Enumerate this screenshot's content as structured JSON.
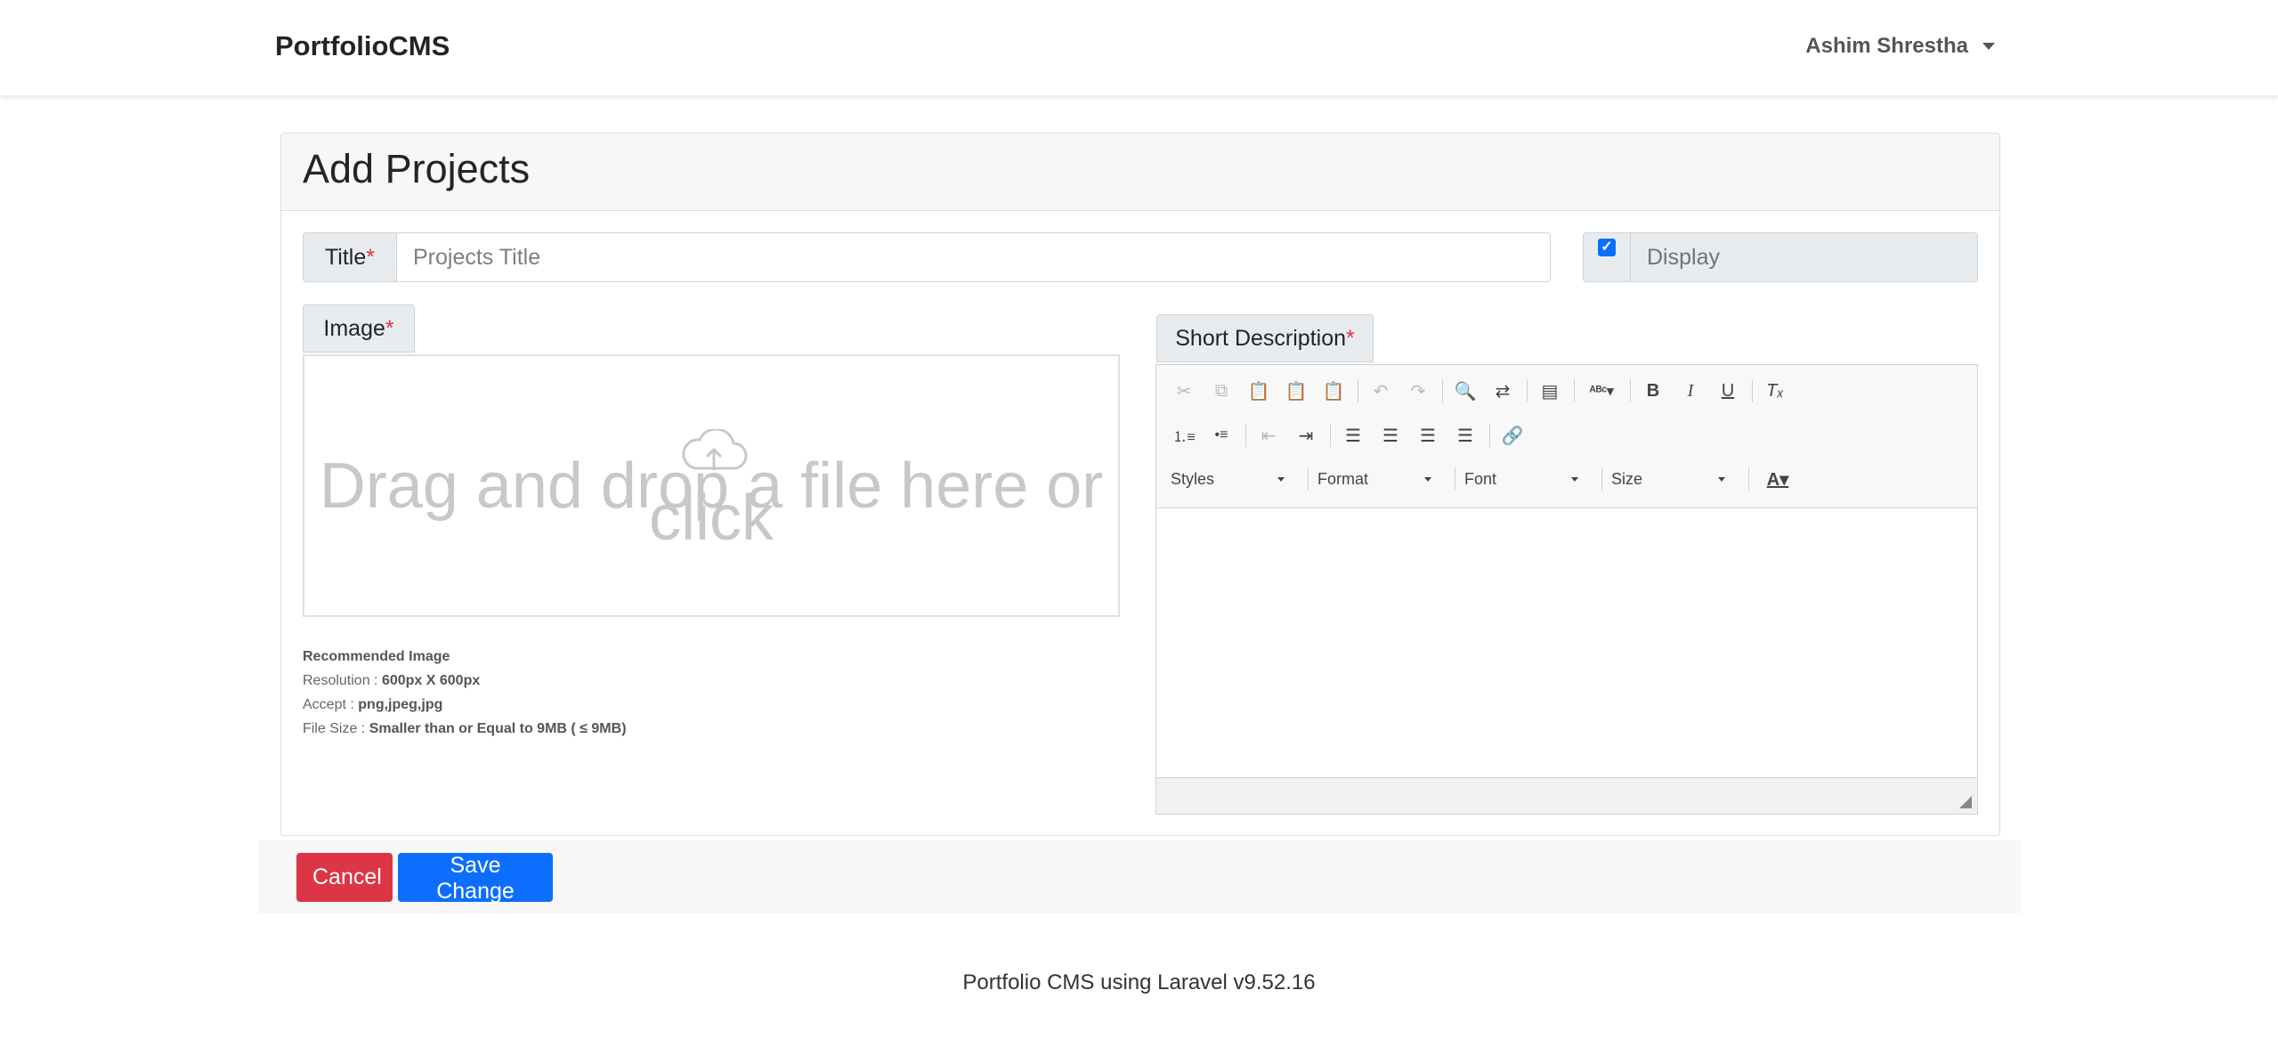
{
  "navbar": {
    "brand": "PortfolioCMS",
    "user_name": "Ashim Shrestha"
  },
  "card": {
    "title": "Add Projects",
    "title_field": {
      "label": "Title",
      "required_mark": "*",
      "placeholder": "Projects Title",
      "value": ""
    },
    "display": {
      "label": "Display",
      "checked": true
    },
    "image": {
      "label": "Image",
      "required_mark": "*",
      "dropzone_text": "Drag and drop a file here or click",
      "notes": {
        "heading": "Recommended Image",
        "resolution_label": "Resolution :",
        "resolution_value": "600px X 600px",
        "accept_label": "Accept :",
        "accept_value": "png,jpeg,jpg",
        "size_label": "File Size :",
        "size_value": "Smaller than or Equal to 9MB ( ≤ 9MB)"
      }
    },
    "short_description": {
      "label": "Short Description",
      "required_mark": "*",
      "editor": {
        "styles_label": "Styles",
        "format_label": "Format",
        "font_label": "Font",
        "size_label": "Size"
      }
    }
  },
  "actions": {
    "cancel_label": "Cancel",
    "save_label": "Save Change"
  },
  "footer": {
    "text": "Portfolio CMS using Laravel v9.52.16"
  },
  "colors": {
    "primary": "#0d6efd",
    "danger": "#dc3545"
  }
}
